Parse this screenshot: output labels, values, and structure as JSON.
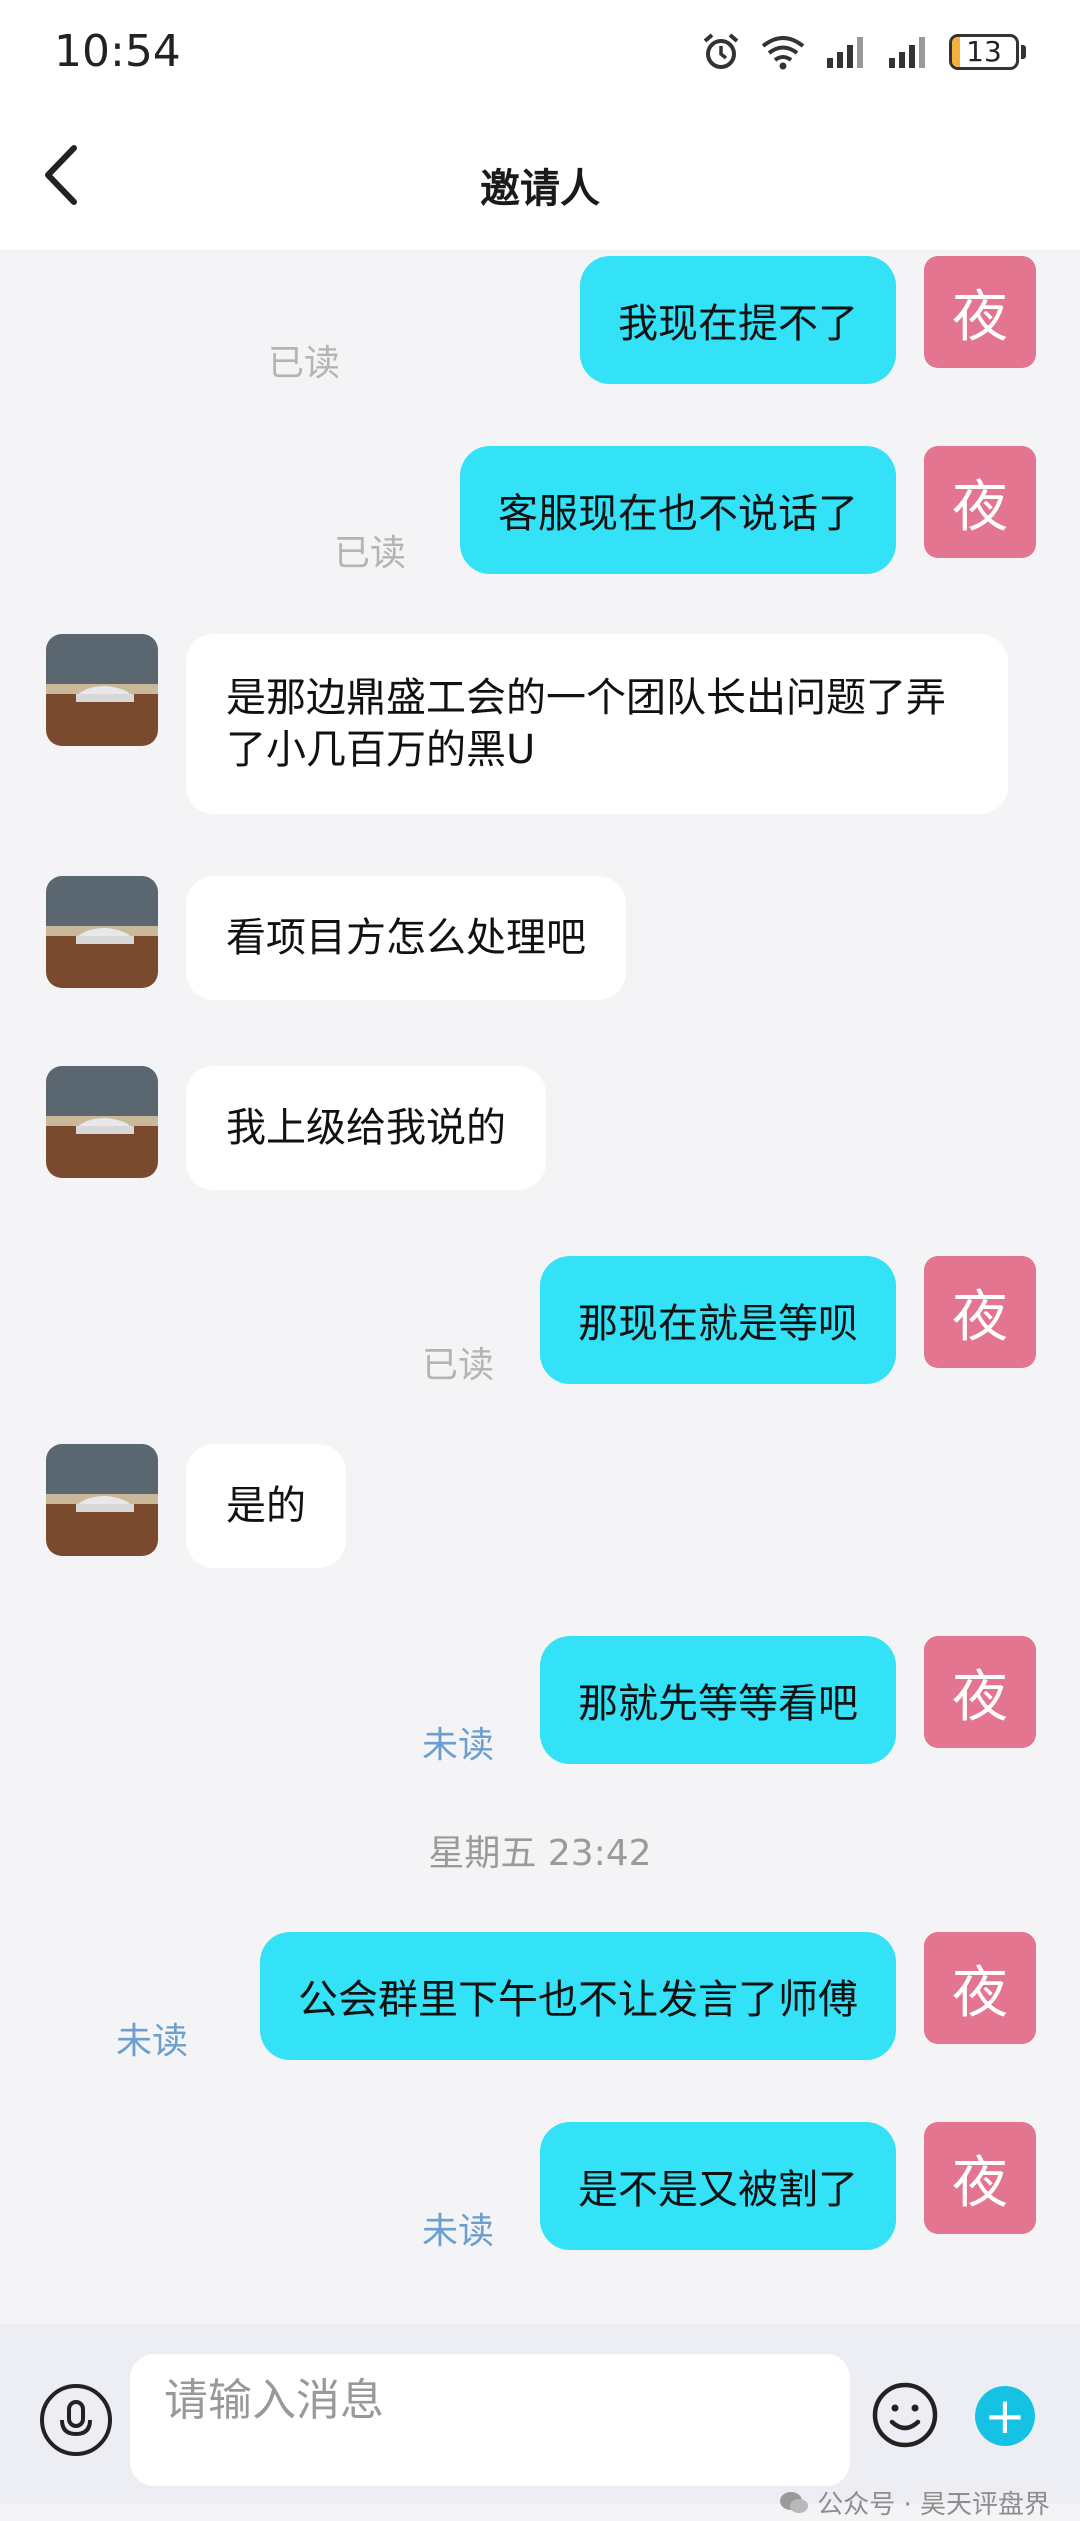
{
  "status_bar": {
    "time": "10:54",
    "battery_level": "13",
    "icons": [
      "alarm-icon",
      "wifi-icon",
      "signal-icon",
      "signal-icon",
      "battery-icon"
    ]
  },
  "header": {
    "title": "邀请人"
  },
  "colors": {
    "my_bubble": "#33e2f7",
    "my_avatar": "#e47590",
    "read": "#b4b4b4",
    "unread": "#6a9fcf",
    "battery_fill": "#f4b23c"
  },
  "my_avatar_label": "夜",
  "messages": [
    {
      "sender": "me",
      "text": "我现在提不了",
      "status": "已读"
    },
    {
      "sender": "me",
      "text": "客服现在也不说话了",
      "status": "已读"
    },
    {
      "sender": "other",
      "text": "是那边鼎盛工会的一个团队长出问题了弄了小几百万的黑U"
    },
    {
      "sender": "other",
      "text": "看项目方怎么处理吧"
    },
    {
      "sender": "other",
      "text": "我上级给我说的"
    },
    {
      "sender": "me",
      "text": "那现在就是等呗",
      "status": "已读"
    },
    {
      "sender": "other",
      "text": "是的"
    },
    {
      "sender": "me",
      "text": "那就先等等看吧",
      "status": "未读"
    },
    {
      "sender": "timestamp",
      "text": "星期五 23:42"
    },
    {
      "sender": "me",
      "text": "公会群里下午也不让发言了师傅",
      "status": "未读"
    },
    {
      "sender": "me",
      "text": "是不是又被割了",
      "status": "未读"
    }
  ],
  "input_bar": {
    "placeholder": "请输入消息",
    "plus_label": "+"
  },
  "watermark": "公众号 · 昊天评盘界"
}
